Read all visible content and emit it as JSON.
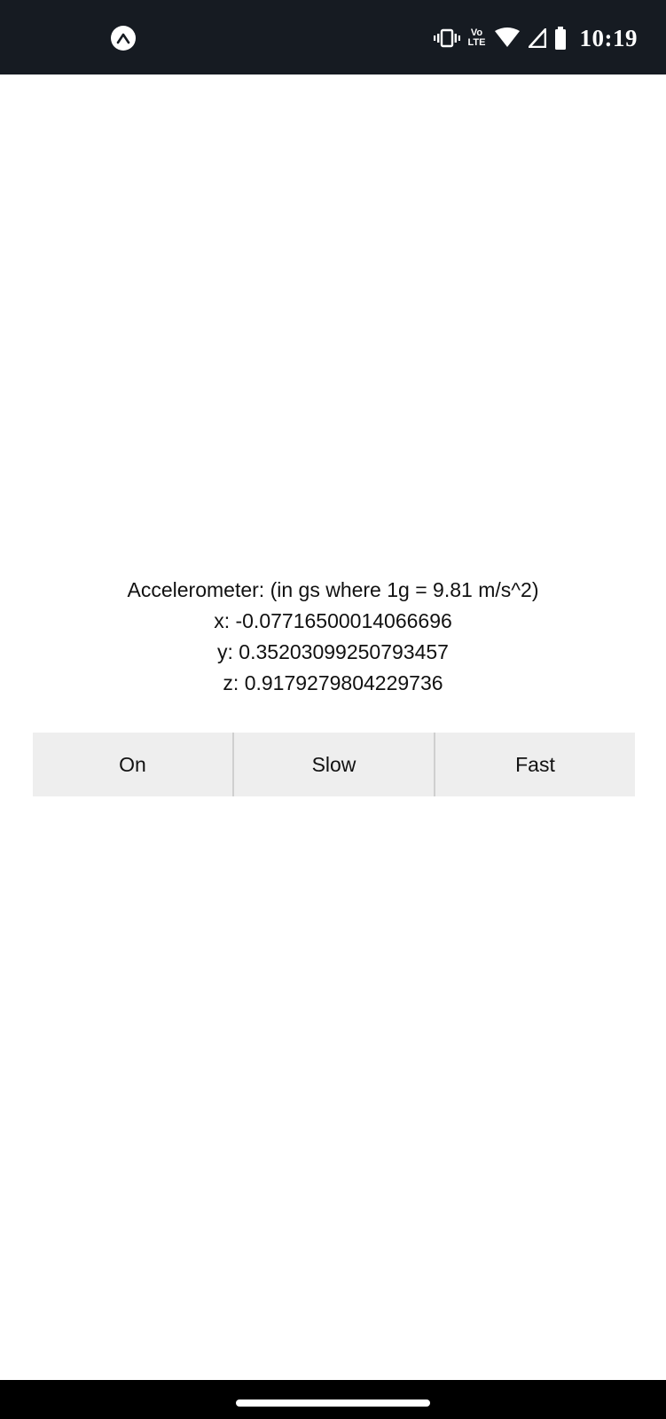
{
  "status_bar": {
    "time": "10:19",
    "volte_top": "Vo",
    "volte_bottom": "LTE",
    "icons": [
      "expo-icon",
      "vibrate-icon",
      "volte-icon",
      "wifi-icon",
      "cell-signal-icon",
      "battery-icon"
    ],
    "background_color": "#161b22"
  },
  "accelerometer": {
    "title": "Accelerometer: (in gs where 1g = 9.81 m/s^2)",
    "x_text": "x: -0.07716500014066696",
    "y_text": "y: 0.35203099250793457",
    "z_text": "z: 0.9179279804229736"
  },
  "buttons": {
    "on_label": "On",
    "slow_label": "Slow",
    "fast_label": "Fast",
    "background_color": "#eeeeee"
  }
}
